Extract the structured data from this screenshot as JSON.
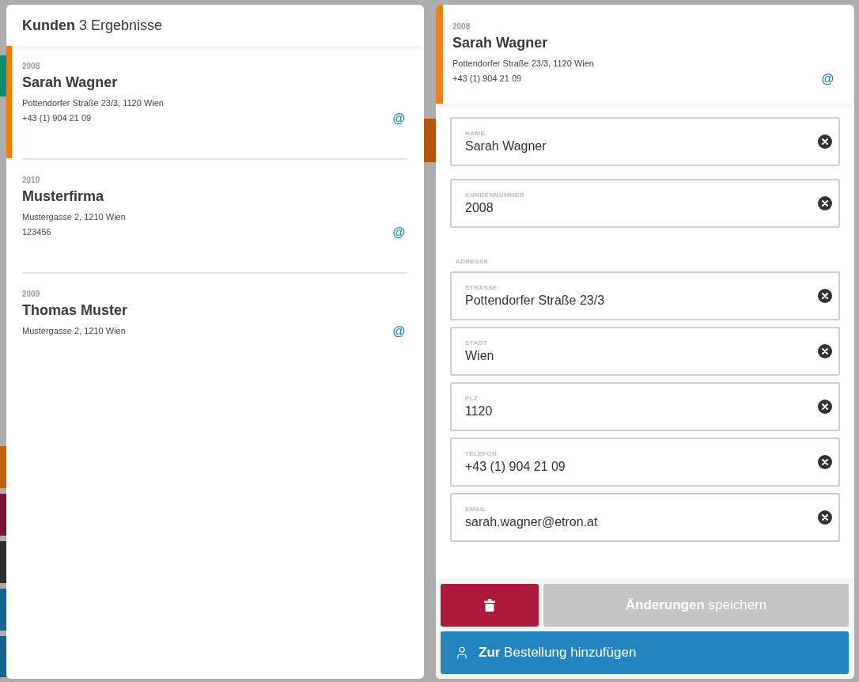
{
  "customers": {
    "title": "Kunden",
    "count": "3 Ergebnisse",
    "items": [
      {
        "number": "2008",
        "name": "Sarah Wagner",
        "address": "Pottendorfer Straße 23/3, 1120 Wien",
        "phone": "+43 (1) 904 21 09",
        "email_icon": "@",
        "selected": true
      },
      {
        "number": "2010",
        "name": "Musterfirma",
        "address": "Mustergasse 2, 1210 Wien",
        "phone": "123456",
        "email_icon": "@",
        "selected": false
      },
      {
        "number": "2009",
        "name": "Thomas Muster",
        "address": "Mustergasse 2, 1210 Wien",
        "email_icon": "@",
        "selected": false
      }
    ]
  },
  "detail": {
    "number": "2008",
    "name": "Sarah Wagner",
    "address": "Pottendorfer Straße 23/3, 1120 Wien",
    "phone": "+43 (1) 904 21 09",
    "email_icon": "@"
  },
  "form": {
    "fields": [
      {
        "label": "NAME",
        "value": "Sarah Wagner"
      },
      {
        "label": "KUNDENNUMMER",
        "value": "2008"
      }
    ],
    "section": "ADRESSE",
    "address_fields": [
      {
        "label": "STRASSE",
        "value": "Pottendorfer Straße 23/3"
      },
      {
        "label": "STADT",
        "value": "Wien"
      },
      {
        "label": "PLZ",
        "value": "1120"
      },
      {
        "label": "TELEFON",
        "value": "+43 (1) 904 21 09"
      },
      {
        "label": "EMAIL",
        "value": "sarah.wagner@etron.at"
      }
    ]
  },
  "actions": {
    "save": {
      "label": "**Änderungen** speichern",
      "disabled": true
    },
    "add": {
      "label": "**Zur** Bestellung hinzufügen"
    }
  }
}
